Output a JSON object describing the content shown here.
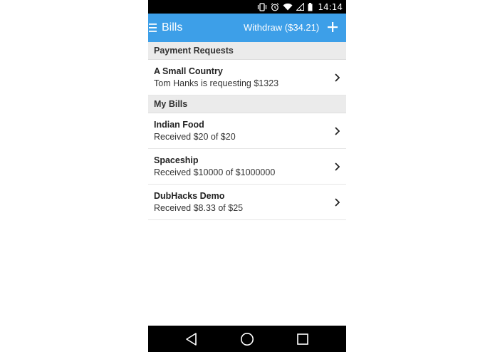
{
  "status_bar": {
    "time": "14:14",
    "icons": [
      "vibrate-icon",
      "alarm-icon",
      "wifi-icon",
      "signal-icon",
      "battery-icon"
    ]
  },
  "app_bar": {
    "menu_icon": "hamburger-menu-icon",
    "title": "Bills",
    "withdraw_label": "Withdraw ($34.21)",
    "add_icon": "plus-icon",
    "color": "#3d9fe8"
  },
  "sections": [
    {
      "header": "Payment Requests",
      "items": [
        {
          "title": "A Small Country",
          "subtitle": "Tom Hanks is requesting $1323"
        }
      ]
    },
    {
      "header": "My Bills",
      "items": [
        {
          "title": "Indian Food",
          "subtitle": "Received $20 of $20"
        },
        {
          "title": "Spaceship",
          "subtitle": "Received $10000 of $1000000"
        },
        {
          "title": "DubHacks Demo",
          "subtitle": "Received $8.33 of $25"
        }
      ]
    }
  ],
  "nav_bar": {
    "icons": [
      "back-icon",
      "home-icon",
      "recents-icon"
    ]
  }
}
